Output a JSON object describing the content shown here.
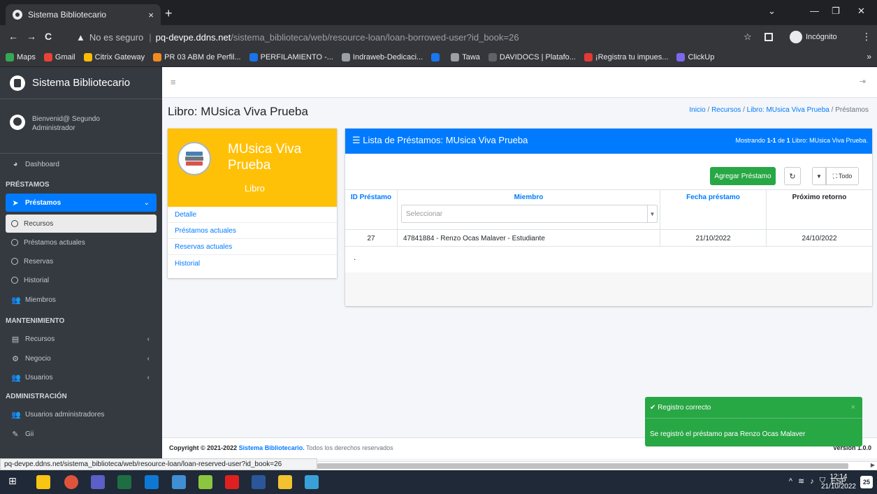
{
  "browser": {
    "tab_title": "Sistema Bibliotecario",
    "tab_close": "×",
    "new_tab": "+",
    "security_warning": "No es seguro",
    "url_host": "pq-devpe.ddns.net",
    "url_path": "/sistema_biblioteca/web/resource-loan/loan-borrowed-user?id_book=26",
    "incognito_label": "Incógnito",
    "bookmarks": [
      {
        "label": "Maps",
        "color": "#34a853"
      },
      {
        "label": "Gmail",
        "color": "#ea4335"
      },
      {
        "label": "Citrix Gateway",
        "color": "#fbbc04"
      },
      {
        "label": "PR 03 ABM de Perfil...",
        "color": "#f28b22"
      },
      {
        "label": "PERFILAMIENTO -...",
        "color": "#1a73e8"
      },
      {
        "label": "Indraweb-Dedicaci...",
        "color": "#9aa0a6"
      },
      {
        "label": "",
        "color": "#1877f2"
      },
      {
        "label": "Tawa",
        "color": "#9aa0a6"
      },
      {
        "label": "DAVIDOCS | Platafo...",
        "color": "#5f6368"
      },
      {
        "label": "¡Registra tu impues...",
        "color": "#e53935"
      },
      {
        "label": "ClickUp",
        "color": "#7b68ee"
      }
    ],
    "bookmarks_more": "»",
    "status_url": "pq-devpe.ddns.net/sistema_biblioteca/web/resource-loan/loan-reserved-user?id_book=26"
  },
  "sidebar": {
    "brand": "Sistema Bibliotecario",
    "user_greeting": "Bienvenid@ Segundo",
    "user_role": "Administrador",
    "dashboard": "Dashboard",
    "section_prestamos": "PRÉSTAMOS",
    "prestamos": "Préstamos",
    "recursos": "Recursos",
    "prestamos_actuales": "Préstamos actuales",
    "reservas": "Reservas",
    "historial": "Historial",
    "miembros": "Miembros",
    "section_mantenimiento": "MANTENIMIENTO",
    "m_recursos": "Recursos",
    "m_negocio": "Negocio",
    "m_usuarios": "Usuarios",
    "section_admin": "ADMINISTRACIÓN",
    "usuarios_admin": "Usuarios administradores",
    "gii": "Gii"
  },
  "page": {
    "title": "Libro: MUsica Viva Prueba",
    "breadcrumb": {
      "inicio": "Inicio",
      "recursos": "Recursos",
      "libro": "Libro: MUsica Viva Prueba",
      "current": "Préstamos",
      "sep": "/"
    }
  },
  "book": {
    "name": "MUsica Viva Prueba",
    "type": "Libro",
    "links": [
      "Detalle",
      "Préstamos actuales",
      "Reservas actuales",
      "Historial"
    ]
  },
  "loans": {
    "title": "Lista de Préstamos: MUsica Viva Prueba",
    "count_prefix": "Mostrando ",
    "count_range": "1-1",
    "count_mid": " de ",
    "count_total": "1",
    "count_suffix": " Libro: MUsica Viva Prueba.",
    "btn_add": "Agregar Préstamo",
    "btn_all": "Todo",
    "columns": [
      "ID Préstamo",
      "Miembro",
      "Fecha préstamo",
      "Próximo retorno"
    ],
    "member_filter_placeholder": "Seleccionar",
    "rows": [
      {
        "id": "27",
        "member": "47841884 - Renzo Ocas Malaver - Estudiante",
        "loan_date": "21/10/2022",
        "return_date": "24/10/2022"
      }
    ],
    "dot": "."
  },
  "footer": {
    "copyright_prefix": "Copyright © 2021-2022 ",
    "copyright_link": "Sistema Bibliotecario.",
    "copyright_suffix": " Todos los derechos reservados",
    "version": "Version 1.0.0"
  },
  "toast": {
    "title": "Registro correcto",
    "body": "Se registró el préstamo para Renzo Ocas Malaver",
    "close": "×",
    "color": "#28a745"
  },
  "taskbar": {
    "time": "12:14",
    "date": "21/10/2022",
    "lang": "ESP",
    "notifications": "25"
  }
}
